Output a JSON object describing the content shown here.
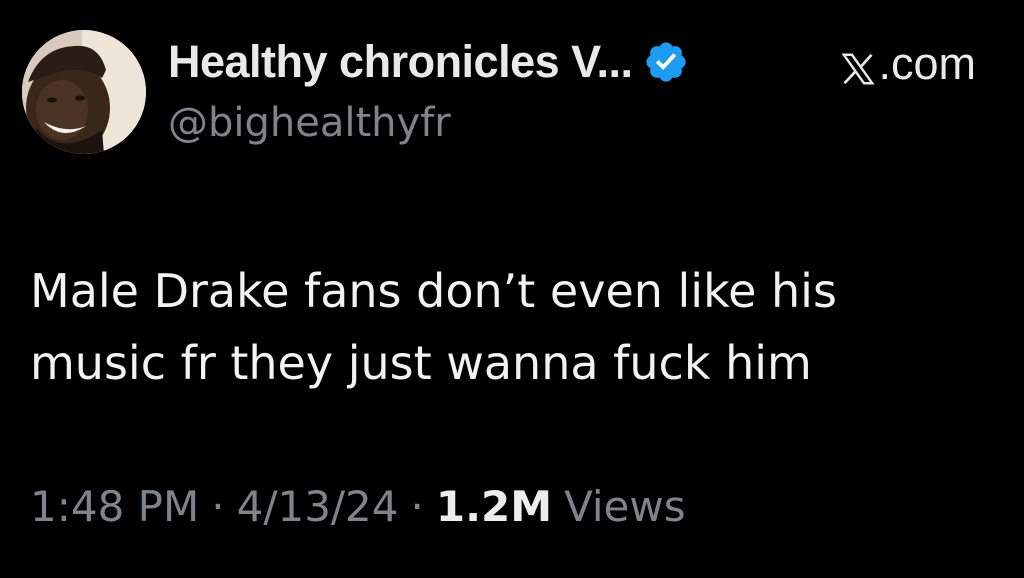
{
  "tweet": {
    "author": {
      "display_name": "Healthy chronicles V...",
      "handle": "@bighealthyfr",
      "verified": true,
      "verified_color": "#1d9bf0",
      "avatar_icon": "profile-photo"
    },
    "source_label": ".com",
    "source_icon": "x-logo-icon",
    "text_lines": [
      "Male Drake fans don’t even like his",
      "music fr they just wanna fuck him"
    ],
    "meta": {
      "time": "1:48 PM",
      "separator": "·",
      "date": "4/13/24",
      "views_count": "1.2M",
      "views_label": "Views"
    }
  },
  "colors": {
    "background": "#000000",
    "primary_text": "#f2f2f2",
    "secondary_text": "#7f848a",
    "accent": "#1d9bf0"
  }
}
